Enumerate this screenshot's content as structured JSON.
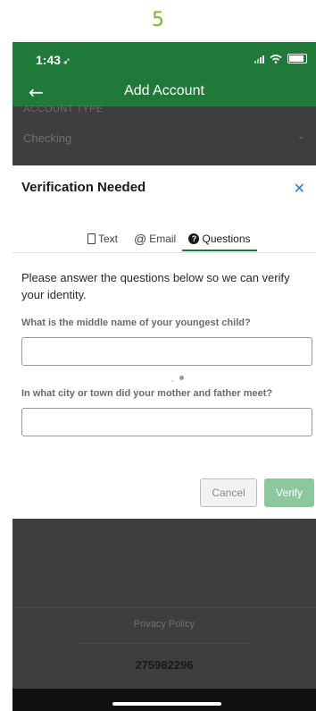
{
  "step_number": "5",
  "status_bar": {
    "time": "1:43",
    "location_glyph": "➶",
    "icons": [
      "signal-icon",
      "wifi-icon",
      "battery-icon"
    ]
  },
  "nav": {
    "back_glyph": "←",
    "title": "Add Account"
  },
  "background_form": {
    "field_label": "ACCOUNT TYPE",
    "field_value": "Checking",
    "chevron_glyph": "⌄"
  },
  "modal": {
    "title": "Verification Needed",
    "close_glyph": "✕",
    "tabs": [
      {
        "label": "Text",
        "icon": "phone-icon",
        "active": false
      },
      {
        "label": "Email",
        "icon": "at-sign-icon",
        "active": false
      },
      {
        "label": "Questions",
        "icon": "question-icon",
        "active": true
      }
    ],
    "intro": "Please answer the questions below so we can verify your identity.",
    "questions": [
      {
        "label": "What is the middle name of your youngest child?",
        "value": ""
      },
      {
        "label": "In what city or town did your mother and father meet?",
        "value": ""
      }
    ],
    "cancel_label": "Cancel",
    "verify_label": "Verify"
  },
  "footer": {
    "privacy_label": "Privacy Policy",
    "account_number": "275982296"
  },
  "colors": {
    "header_green": "#1f7a3a",
    "step_green": "#7ab829",
    "close_blue": "#2a7ad5",
    "verify_disabled": "#8cc89f"
  }
}
